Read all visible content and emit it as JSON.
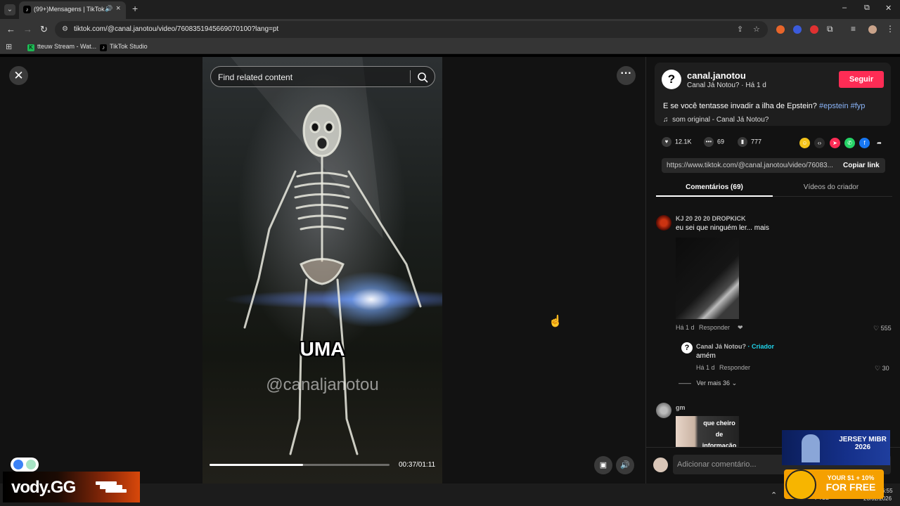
{
  "browser": {
    "tab_title": "(99+)Mensagens | TikTok",
    "new_tab": "+",
    "url": "tiktok.com/@canal.janotou/video/7608351945669070100?lang=pt",
    "win_min": "–",
    "win_max": "⧉",
    "win_close": "✕"
  },
  "bookmarks": [
    {
      "label": "tteuw Stream - Wat...",
      "color": "#1db954"
    },
    {
      "label": "TikTok Studio",
      "color": "#000000"
    }
  ],
  "video": {
    "search_placeholder": "Find related content",
    "caption": "UMA",
    "watermark": "@canaljanotou",
    "time": "00:37/01:11",
    "progress": 0.52
  },
  "post": {
    "author": "canal.janotou",
    "author_sub": "Canal Já Notou? · Há 1 d",
    "follow": "Seguir",
    "desc_text": "E se você tentasse invadir a ilha de Epstein? ",
    "desc_tags": "#epstein #fyp",
    "music": "som original - Canal Já Notou?",
    "likes": "12.1K",
    "comments_count": "69",
    "saves": "777",
    "link_url": "https://www.tiktok.com/@canal.janotou/video/76083...",
    "copy_link": "Copiar link",
    "tab_comments": "Comentários (69)",
    "tab_videos": "Vídeos do criador"
  },
  "comments": {
    "c1": {
      "user": "KJ 20 20 20 DROPKICK",
      "text": "eu sei que ninguém ler... mais",
      "time": "Há 1 d",
      "reply": "Responder",
      "likes": "555"
    },
    "r1": {
      "user": "Canal Já Notou?",
      "badge": "· Criador",
      "text": "amém",
      "time": "Há 1 d",
      "reply": "Responder",
      "likes": "30"
    },
    "see_more": "Ver mais 36",
    "c2": {
      "user": "gm",
      "img_text": "que cheiro de informação tirada de..."
    },
    "placeholder": "Adicionar comentário..."
  },
  "overlays": {
    "vody": "vody.GG",
    "ad1": "JERSEY MIBR 2026",
    "ad2_line1": "YOUR $1 + 10%",
    "ad2_line2": "FOR FREE",
    "tray_lang": "PTB2",
    "tray_time": "6:55",
    "tray_date": "20/02/2026"
  }
}
